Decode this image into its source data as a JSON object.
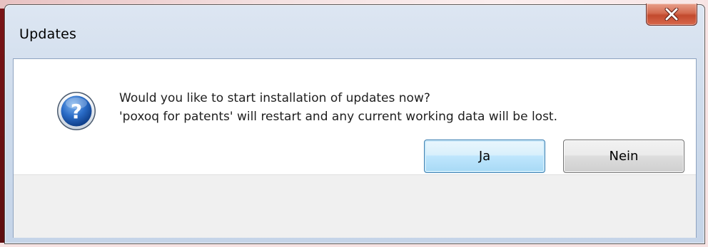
{
  "window": {
    "title": "Updates",
    "close_tooltip_icon": "close-icon"
  },
  "dialog": {
    "icon": "question-icon",
    "message_line1": "Would you like to start installation of updates now?",
    "message_line2": "'poxoq for patents' will restart and any current working data will be lost."
  },
  "buttons": {
    "yes_label": "Ja",
    "no_label": "Nein"
  },
  "colors": {
    "background_left": "#7a1416",
    "icon_blue": "#1f5fb5",
    "close_red": "#c24a2e"
  }
}
